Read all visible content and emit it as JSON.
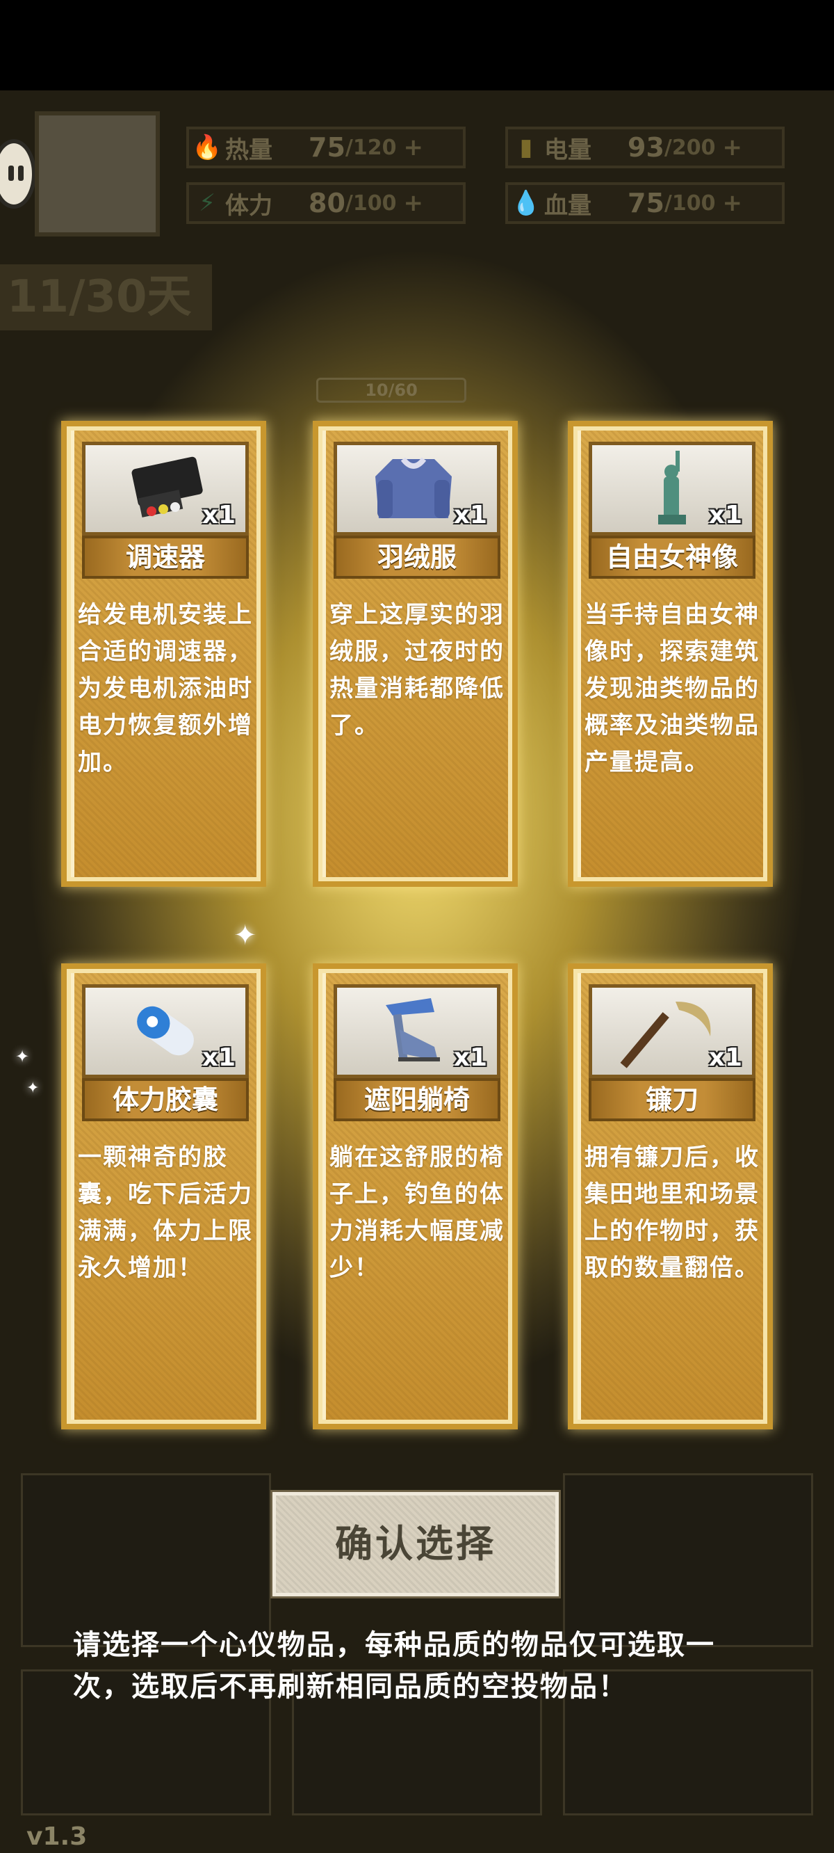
{
  "header": {
    "stats": [
      {
        "name": "热量",
        "value": "75",
        "max": "/120",
        "plus": "+",
        "icon": "flame-icon"
      },
      {
        "name": "电量",
        "value": "93",
        "max": "/200",
        "plus": "+",
        "icon": "battery-icon"
      },
      {
        "name": "体力",
        "value": "80",
        "max": "/100",
        "plus": "+",
        "icon": "lightning-icon"
      },
      {
        "name": "血量",
        "value": "75",
        "max": "/100",
        "plus": "+",
        "icon": "blood-drop-icon"
      }
    ],
    "day": "11/30天",
    "progress": "10/60"
  },
  "cards": [
    {
      "name": "调速器",
      "qty": "x1",
      "desc": "给发电机安装上合适的调速器，为发电机添油时电力恢复额外增加。",
      "icon": "speed-controller-icon"
    },
    {
      "name": "羽绒服",
      "qty": "x1",
      "desc": "穿上这厚实的羽绒服，过夜时的热量消耗都降低了。",
      "icon": "down-jacket-icon"
    },
    {
      "name": "自由女神像",
      "qty": "x1",
      "desc": "当手持自由女神像时，探索建筑发现油类物品的概率及油类物品产量提高。",
      "icon": "statue-of-liberty-icon"
    },
    {
      "name": "体力胶囊",
      "qty": "x1",
      "desc": "一颗神奇的胶囊，吃下后活力满满，体力上限永久增加！",
      "icon": "capsule-icon"
    },
    {
      "name": "遮阳躺椅",
      "qty": "x1",
      "desc": "躺在这舒服的椅子上，钓鱼的体力消耗大幅度减少！",
      "icon": "beach-chair-icon"
    },
    {
      "name": "镰刀",
      "qty": "x1",
      "desc": "拥有镰刀后，收集田地里和场景上的作物时，获取的数量翻倍。",
      "icon": "sickle-icon"
    }
  ],
  "confirm_label": "确认选择",
  "hint": "请选择一个心仪物品，每种品质的物品仅可选取一次，选取后不再刷新相同品质的空投物品！",
  "version": "v1.3"
}
